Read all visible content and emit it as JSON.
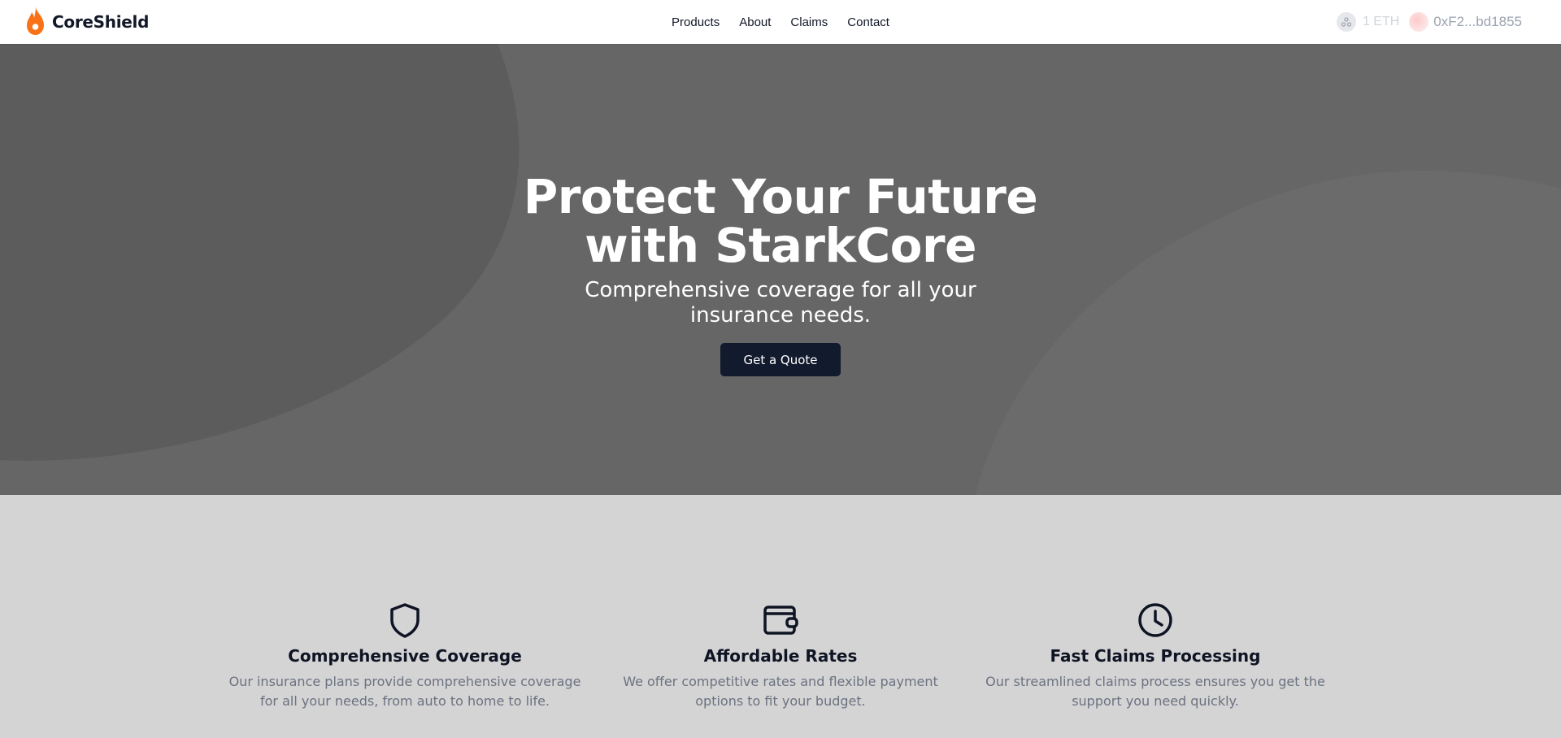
{
  "nav": {
    "brand": "CoreShield",
    "links": [
      "Products",
      "About",
      "Claims",
      "Contact"
    ],
    "balance": "1 ETH",
    "wallet_address": "0xF2...bd1855"
  },
  "hero": {
    "title": "Protect Your Future with StarkCore",
    "subtitle": "Comprehensive coverage for all your insurance needs.",
    "cta_label": "Get a Quote"
  },
  "features": [
    {
      "icon": "shield-icon",
      "title": "Comprehensive Coverage",
      "description": "Our insurance plans provide comprehensive coverage for all your needs, from auto to home to life."
    },
    {
      "icon": "wallet-icon",
      "title": "Affordable Rates",
      "description": "We offer competitive rates and flexible payment options to fit your budget."
    },
    {
      "icon": "clock-icon",
      "title": "Fast Claims Processing",
      "description": "Our streamlined claims process ensures you get the support you need quickly."
    }
  ],
  "colors": {
    "brand_accent": "#f97316",
    "hero_bg": "#666666",
    "cta_bg": "#121a2e",
    "features_bg": "#d4d4d4"
  }
}
